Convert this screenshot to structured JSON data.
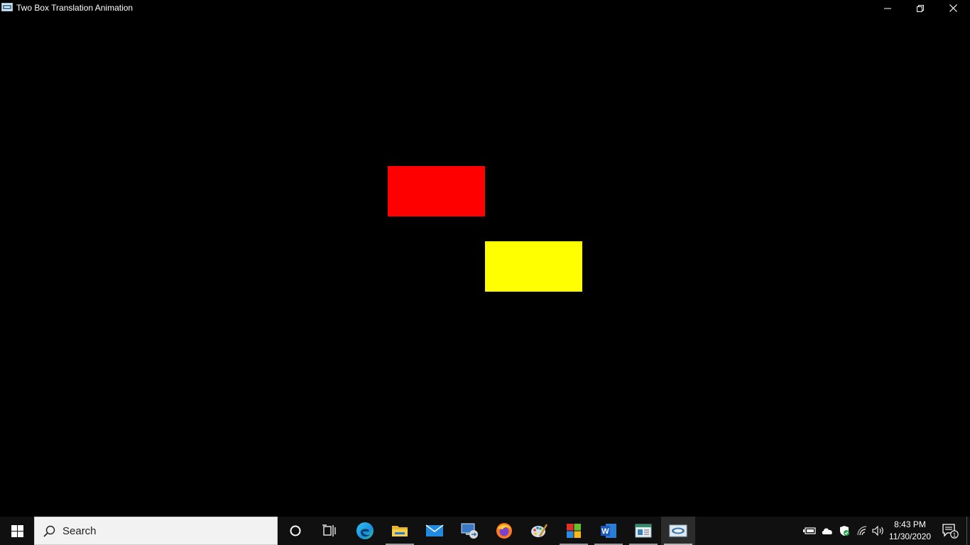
{
  "window": {
    "title": "Two Box Translation Animation",
    "background_color": "#000000",
    "controls": [
      "minimize-icon",
      "restore-icon",
      "close-icon"
    ]
  },
  "scene": {
    "boxes": [
      {
        "name": "red-box",
        "color": "#ff0000"
      },
      {
        "name": "yellow-box",
        "color": "#ffff00"
      }
    ]
  },
  "taskbar": {
    "search_placeholder": "Search",
    "apps": [
      "windows-start-icon",
      "cortana-icon",
      "task-view-icon",
      "edge-icon",
      "file-explorer-icon",
      "mail-icon",
      "remote-desktop-icon",
      "firefox-icon",
      "paint-icon",
      "windows-apps-icon",
      "word-icon",
      "notes-icon",
      "opengl-app-icon"
    ],
    "clock": {
      "time": "8:43 PM",
      "date": "11/30/2020"
    },
    "notification_count": "1"
  }
}
